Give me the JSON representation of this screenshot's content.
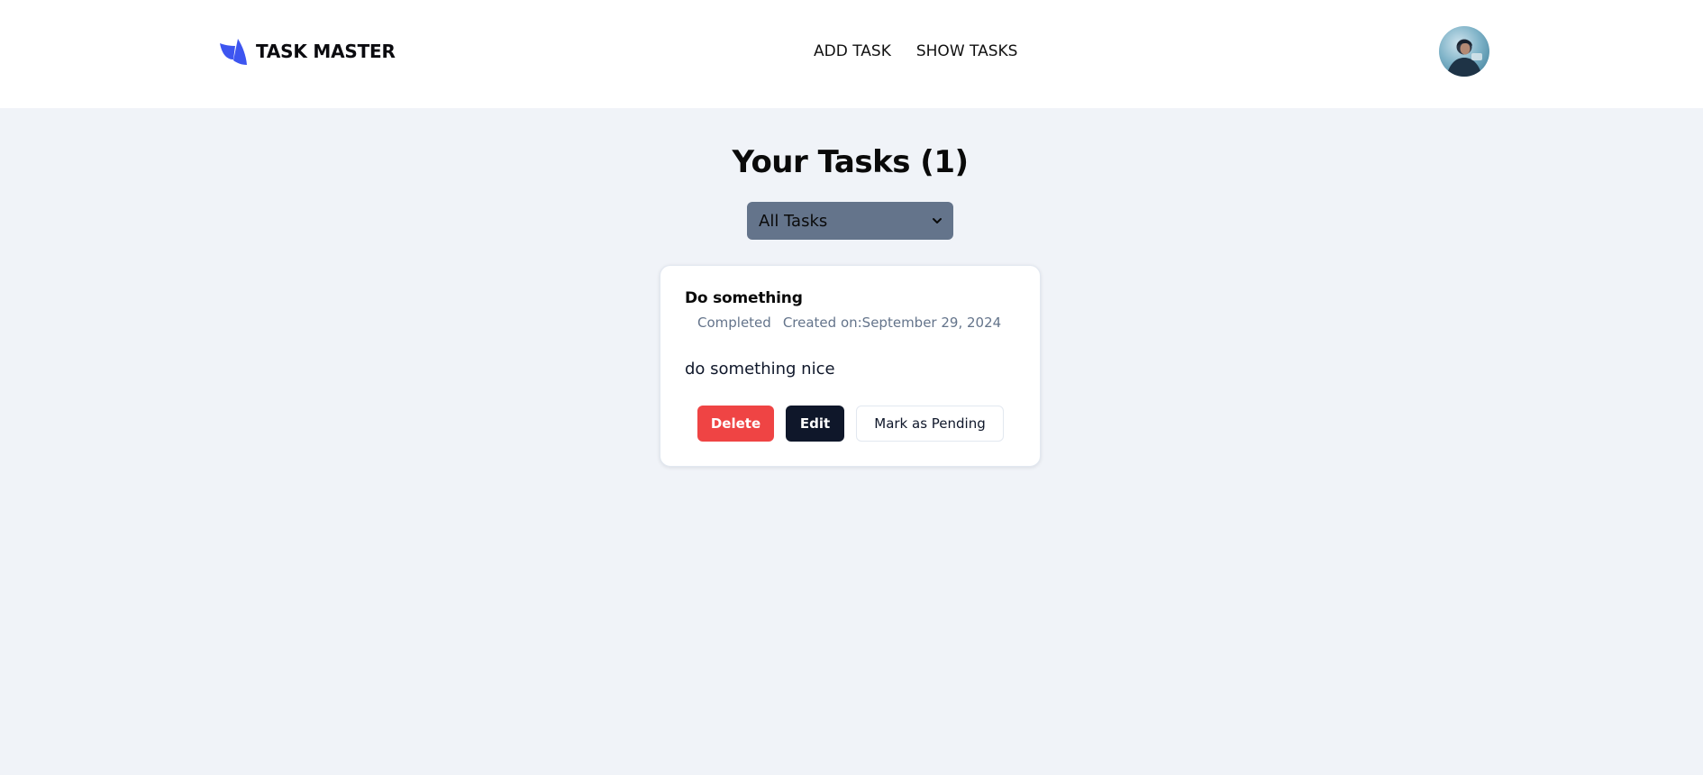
{
  "header": {
    "brand_name": "TASK MASTER",
    "logo_icon": "sail-logo-icon",
    "nav_links": [
      "ADD TASK",
      "SHOW TASKS"
    ],
    "avatar_icon": "user-avatar"
  },
  "main": {
    "title": "Your Tasks (1)",
    "filter": {
      "selected": "All Tasks",
      "icon": "chevron-down-icon"
    }
  },
  "task": {
    "title": "Do something",
    "status": "Completed",
    "created": "Created on:September 29, 2024",
    "description": "do something nice",
    "buttons": {
      "delete": "Delete",
      "edit": "Edit",
      "toggle": "Mark as Pending"
    }
  },
  "colors": {
    "page_bg": "#f0f3f8",
    "brand_accent": "#3d55f0",
    "select_bg": "#64748b",
    "delete_bg": "#ef4444",
    "edit_bg": "#0f172a",
    "muted_text": "#64748b"
  }
}
